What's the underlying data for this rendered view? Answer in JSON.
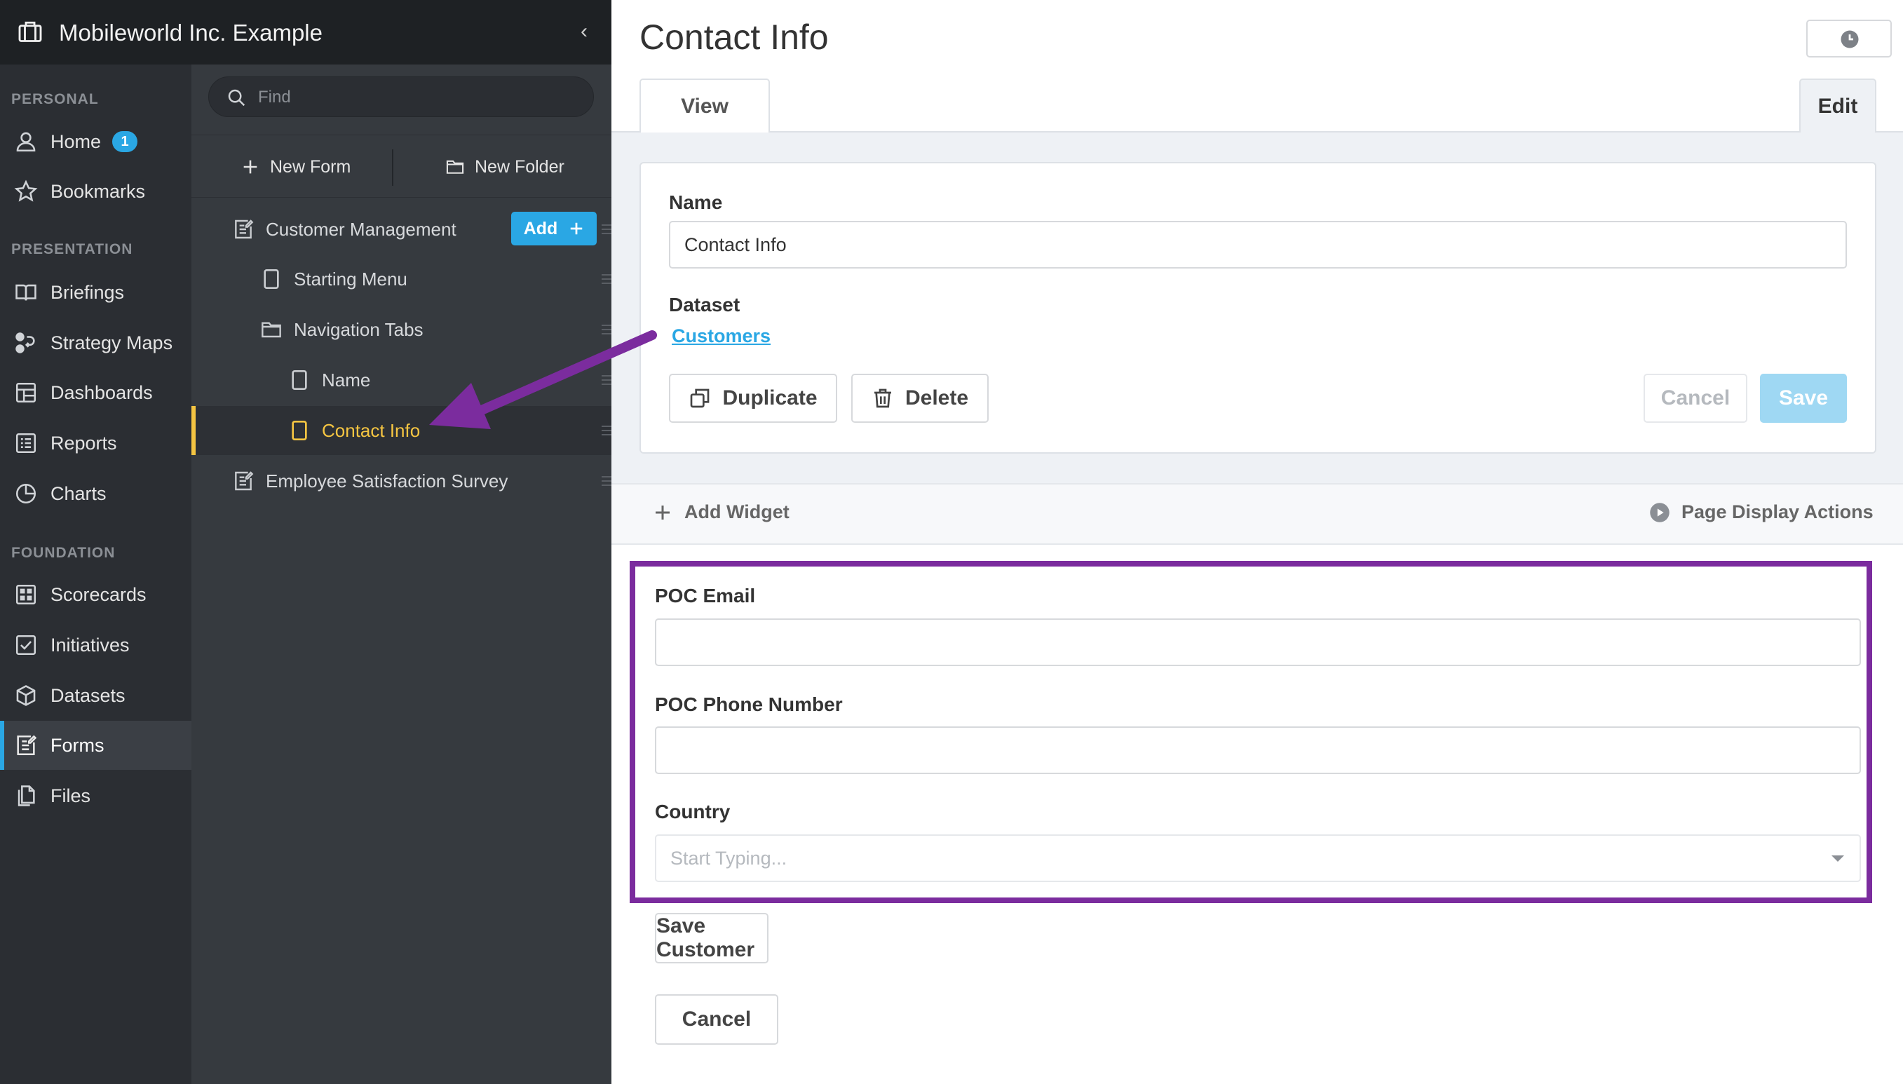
{
  "app": {
    "org_name": "Mobileworld Inc. Example",
    "collapse_glyph": "‹"
  },
  "nav": {
    "sections": {
      "personal": "PERSONAL",
      "presentation": "PRESENTATION",
      "foundation": "FOUNDATION"
    },
    "items": {
      "home": {
        "label": "Home",
        "badge": "1",
        "icon": "user-icon"
      },
      "bookmarks": {
        "label": "Bookmarks",
        "icon": "star-icon"
      },
      "briefings": {
        "label": "Briefings",
        "icon": "book-icon"
      },
      "strategy_maps": {
        "label": "Strategy Maps",
        "icon": "strategy-map-icon"
      },
      "dashboards": {
        "label": "Dashboards",
        "icon": "dashboard-icon"
      },
      "reports": {
        "label": "Reports",
        "icon": "report-icon"
      },
      "charts": {
        "label": "Charts",
        "icon": "pie-chart-icon"
      },
      "scorecards": {
        "label": "Scorecards",
        "icon": "scorecard-icon"
      },
      "initiatives": {
        "label": "Initiatives",
        "icon": "checkbox-icon"
      },
      "datasets": {
        "label": "Datasets",
        "icon": "cube-icon"
      },
      "forms": {
        "label": "Forms",
        "icon": "form-icon",
        "active": true
      },
      "files": {
        "label": "Files",
        "icon": "files-icon"
      }
    }
  },
  "tree": {
    "search_placeholder": "Find",
    "new_form_label": "New Form",
    "new_folder_label": "New Folder",
    "add_label": "Add",
    "rows": {
      "customer_management": "Customer Management",
      "starting_menu": "Starting Menu",
      "navigation_tabs": "Navigation Tabs",
      "name": "Name",
      "contact_info": "Contact Info",
      "employee_survey": "Employee Satisfaction Survey"
    }
  },
  "main": {
    "title": "Contact Info",
    "tabs": {
      "view": "View",
      "edit": "Edit"
    },
    "edit_card": {
      "name_label": "Name",
      "name_value": "Contact Info",
      "dataset_label": "Dataset",
      "dataset_link": "Customers",
      "duplicate_label": "Duplicate",
      "delete_label": "Delete",
      "cancel_label": "Cancel",
      "save_label": "Save"
    },
    "widget_bar": {
      "add_widget": "Add Widget",
      "page_display_actions": "Page Display Actions"
    },
    "form": {
      "poc_email_label": "POC Email",
      "poc_email_value": "",
      "poc_phone_label": "POC Phone Number",
      "poc_phone_value": "",
      "country_label": "Country",
      "country_placeholder": "Start Typing...",
      "save_customer_label": "Save Customer",
      "cancel_label": "Cancel"
    }
  },
  "colors": {
    "accent": "#2aa7e4",
    "selected_item": "#f5c542",
    "annotation": "#7b2c9e"
  }
}
